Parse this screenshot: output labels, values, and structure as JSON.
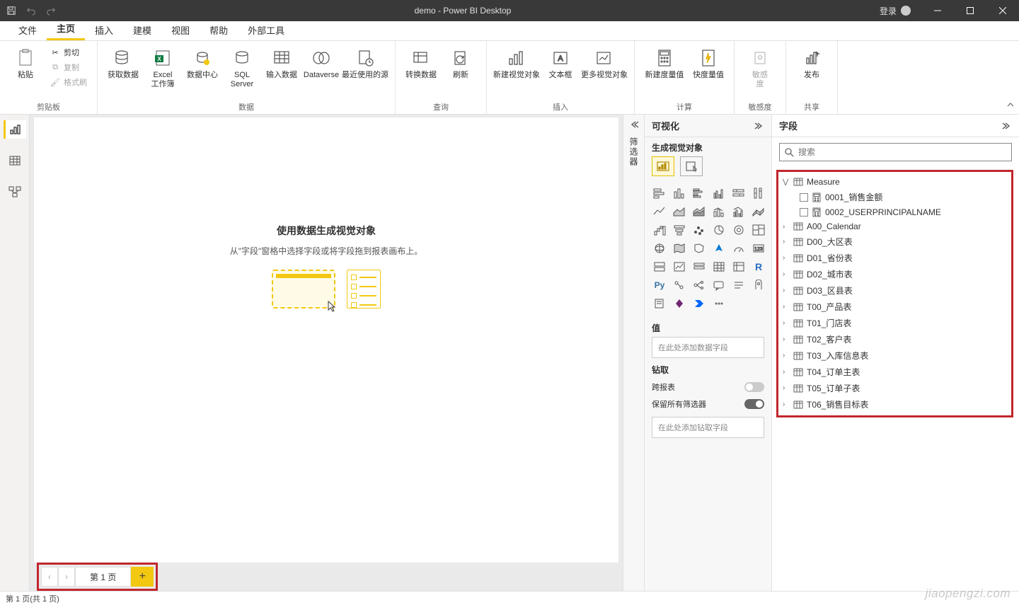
{
  "title": "demo - Power BI Desktop",
  "login": "登录",
  "menu": {
    "file": "文件",
    "home": "主页",
    "insert": "插入",
    "model": "建模",
    "view": "视图",
    "help": "帮助",
    "external": "外部工具"
  },
  "ribbon": {
    "clipboard": {
      "label": "剪贴板",
      "paste": "粘贴",
      "cut": "剪切",
      "copy": "复制",
      "format": "格式刷"
    },
    "data": {
      "label": "数据",
      "getdata": "获取数据",
      "excel": "Excel\n工作簿",
      "hub": "数据中心",
      "sql": "SQL\nServer",
      "enter": "输入数据",
      "dataverse": "Dataverse",
      "recent": "最近使用的源"
    },
    "query": {
      "label": "查询",
      "transform": "转换数据",
      "refresh": "刷新"
    },
    "insert": {
      "label": "插入",
      "newviz": "新建视觉对象",
      "textbox": "文本框",
      "moreviz": "更多视觉对象"
    },
    "calc": {
      "label": "计算",
      "measure": "新建度量值",
      "quick": "快度量值"
    },
    "sens": {
      "label": "敏感度",
      "btn": "敏感\n度"
    },
    "share": {
      "label": "共享",
      "publish": "发布"
    }
  },
  "canvas": {
    "title": "使用数据生成视觉对象",
    "sub": "从\"字段\"窗格中选择字段或将字段拖到报表画布上。"
  },
  "page_tab": "第 1 页",
  "filter_label": "筛选器",
  "viz": {
    "header": "可视化",
    "build": "生成视觉对象",
    "values": "值",
    "values_ph": "在此处添加数据字段",
    "drill": "钻取",
    "cross": "跨报表",
    "keep": "保留所有筛选器",
    "drill_ph": "在此处添加钻取字段"
  },
  "fields": {
    "header": "字段",
    "search_ph": "搜索",
    "tables": [
      {
        "name": "Measure",
        "expanded": true,
        "children": [
          {
            "name": "0001_销售金额"
          },
          {
            "name": "0002_USERPRINCIPALNAME"
          }
        ]
      },
      {
        "name": "A00_Calendar"
      },
      {
        "name": "D00_大区表"
      },
      {
        "name": "D01_省份表"
      },
      {
        "name": "D02_城市表"
      },
      {
        "name": "D03_区县表"
      },
      {
        "name": "T00_产品表"
      },
      {
        "name": "T01_门店表"
      },
      {
        "name": "T02_客户表"
      },
      {
        "name": "T03_入库信息表"
      },
      {
        "name": "T04_订单主表"
      },
      {
        "name": "T05_订单子表"
      },
      {
        "name": "T06_销售目标表"
      }
    ]
  },
  "status": "第 1 页(共 1 页)",
  "watermark": "jiaopengzi.com"
}
